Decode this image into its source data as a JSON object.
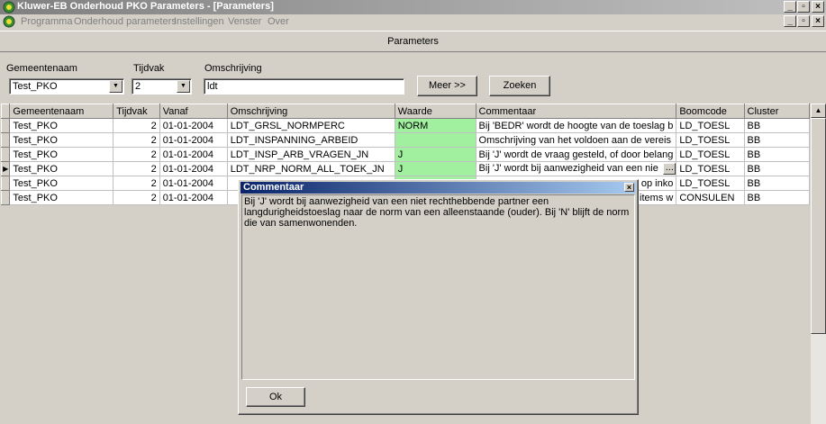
{
  "window": {
    "title": "Kluwer-EB Onderhoud PKO Parameters - [Parameters]"
  },
  "menu": {
    "items": [
      "Programma",
      "Onderhoud parameters",
      "Instellingen",
      "Venster",
      "Over"
    ]
  },
  "header": {
    "caption": "Parameters"
  },
  "form": {
    "gemeentenaam_label": "Gemeentenaam",
    "gemeentenaam_value": "Test_PKO",
    "tijdvak_label": "Tijdvak",
    "tijdvak_value": "2",
    "omschrijving_label": "Omschrijving",
    "omschrijving_value": "ldt",
    "meer_button": "Meer >>",
    "zoeken_button": "Zoeken"
  },
  "grid": {
    "columns": [
      "Gemeentenaam",
      "Tijdvak",
      "Vanaf",
      "Omschrijving",
      "Waarde",
      "Commentaar",
      "Boomcode",
      "Cluster"
    ],
    "rows": [
      [
        "Test_PKO",
        "2",
        "01-01-2004",
        "LDT_GRSL_NORMPERC",
        "NORM",
        "Bij 'BEDR' wordt de hoogte van de toeslag b",
        "LD_TOESL",
        "BB"
      ],
      [
        "Test_PKO",
        "2",
        "01-01-2004",
        "LDT_INSPANNING_ARBEID",
        "",
        "Omschrijving van het voldoen aan de vereis",
        "LD_TOESL",
        "BB"
      ],
      [
        "Test_PKO",
        "2",
        "01-01-2004",
        "LDT_INSP_ARB_VRAGEN_JN",
        "J",
        "Bij 'J' wordt de vraag gesteld, of door belang",
        "LD_TOESL",
        "BB"
      ],
      [
        "Test_PKO",
        "2",
        "01-01-2004",
        "LDT_NRP_NORM_ALL_TOEK_JN",
        "J",
        "Bij 'J' wordt bij aanwezigheid van een nie",
        "LD_TOESL",
        "BB"
      ],
      [
        "Test_PKO",
        "2",
        "01-01-2004",
        "",
        "",
        "op inko",
        "LD_TOESL",
        "BB"
      ],
      [
        "Test_PKO",
        "2",
        "01-01-2004",
        "",
        "",
        "items w",
        "CONSULEN",
        "BB"
      ]
    ],
    "current_row": 3
  },
  "dialog": {
    "title": "Commentaar",
    "text": "Bij 'J' wordt bij aanwezigheid van een niet rechthebbende partner een langdurigheidstoeslag naar de norm van een alleenstaande (ouder). Bij 'N' blijft de norm die van samenwonenden.",
    "ok_button": "Ok"
  },
  "colors": {
    "value_cell_green": "#a0f0a0",
    "dialog_title_blue": "#0a246a"
  }
}
